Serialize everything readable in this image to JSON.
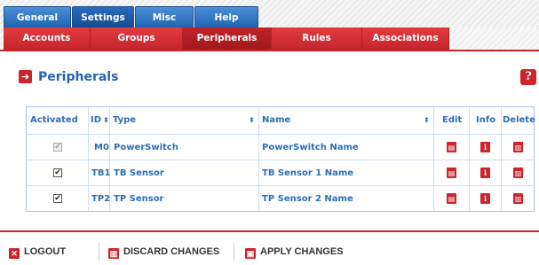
{
  "tabs": [
    {
      "label": "General"
    },
    {
      "label": "Settings"
    },
    {
      "label": "Misc"
    },
    {
      "label": "Help"
    }
  ],
  "subnav": [
    {
      "label": "Accounts"
    },
    {
      "label": "Groups"
    },
    {
      "label": "Peripherals"
    },
    {
      "label": "Rules"
    },
    {
      "label": "Associations"
    }
  ],
  "page": {
    "title": "Peripherals",
    "help": "?"
  },
  "table": {
    "headers": {
      "activated": "Activated",
      "id": "ID",
      "type": "Type",
      "name": "Name",
      "edit": "Edit",
      "info": "Info",
      "delete": "Delete"
    },
    "rows": [
      {
        "activated": true,
        "disabled": true,
        "id": "M0",
        "type": "PowerSwitch",
        "name": "PowerSwitch Name"
      },
      {
        "activated": true,
        "disabled": false,
        "id": "TB1",
        "type": "TB Sensor",
        "name": "TB Sensor 1 Name"
      },
      {
        "activated": true,
        "disabled": false,
        "id": "TP2",
        "type": "TP Sensor",
        "name": "TP Sensor 2 Name"
      }
    ]
  },
  "footer": {
    "logout": "LOGOUT",
    "discard": "DISCARD CHANGES",
    "apply": "APPLY CHANGES"
  },
  "colors": {
    "accent_red": "#c9252b",
    "tab_blue": "#2163b0",
    "link_blue": "#2c6fb6"
  }
}
